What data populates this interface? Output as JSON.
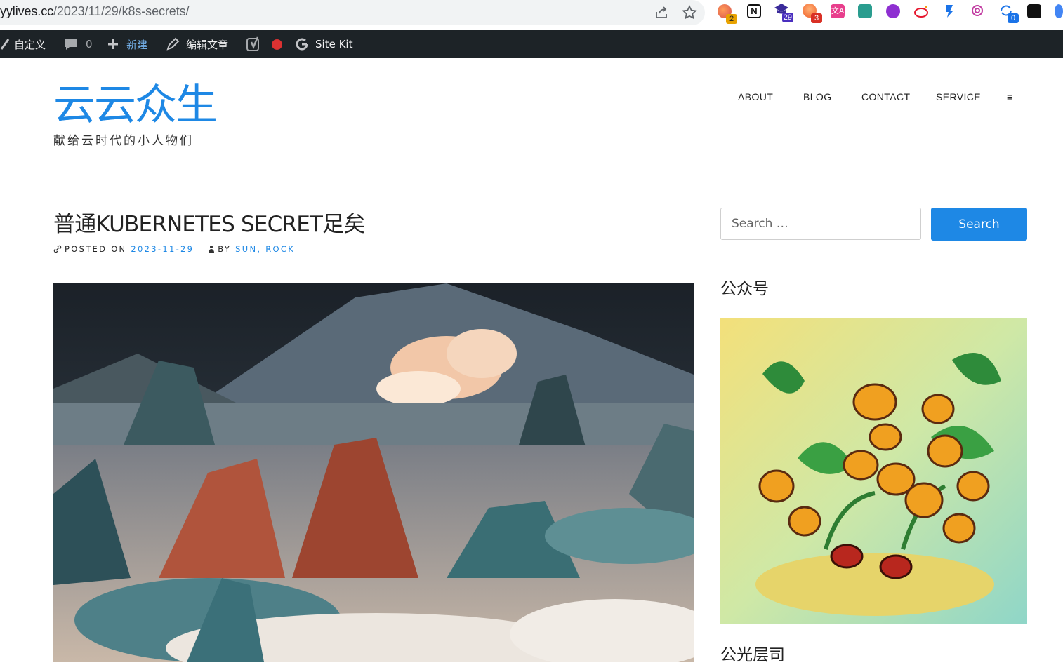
{
  "browser": {
    "url_prefix": "yylives.cc",
    "url_path": "/2023/11/29/k8s-secrets/",
    "extensions": [
      {
        "name": "extension-1-icon",
        "badge": "2",
        "badge_color": "#e8a200"
      },
      {
        "name": "notion-icon",
        "badge": ""
      },
      {
        "name": "extension-3-icon",
        "badge": "29",
        "badge_color": "#4a2fbf"
      },
      {
        "name": "extension-4-icon",
        "badge": "3",
        "badge_color": "#d93025"
      },
      {
        "name": "translate-icon",
        "badge": ""
      },
      {
        "name": "extension-6-icon",
        "badge": ""
      },
      {
        "name": "extension-7-icon",
        "badge": ""
      },
      {
        "name": "weibo-icon",
        "badge": ""
      },
      {
        "name": "extension-9-icon",
        "badge": ""
      },
      {
        "name": "openai-icon",
        "badge": ""
      },
      {
        "name": "extension-11-icon",
        "badge": "0",
        "badge_color": "#1a73e8"
      },
      {
        "name": "extension-12-icon",
        "badge": ""
      },
      {
        "name": "extension-13-icon",
        "badge": ""
      }
    ]
  },
  "adminbar": {
    "customize": "自定义",
    "comments_count": "0",
    "new": "新建",
    "edit": "编辑文章",
    "sitekit": "Site Kit"
  },
  "site": {
    "title": "云云众生",
    "description": "献给云时代的小人物们"
  },
  "nav": {
    "items": [
      "ABOUT",
      "BLOG",
      "CONTACT",
      "SERVICE"
    ],
    "menu_toggle": "≡"
  },
  "post": {
    "title": "普通KUBERNETES SECRET足矣",
    "posted_on_label": "POSTED ON",
    "date": "2023-11-29",
    "by_label": "BY",
    "author": "SUN, ROCK"
  },
  "sidebar": {
    "search_placeholder": "Search …",
    "search_button": "Search",
    "widget1_title": "公众号",
    "widget2_title": "公光层司"
  },
  "colors": {
    "accent": "#1e88e5",
    "adminbar": "#1d2327"
  }
}
